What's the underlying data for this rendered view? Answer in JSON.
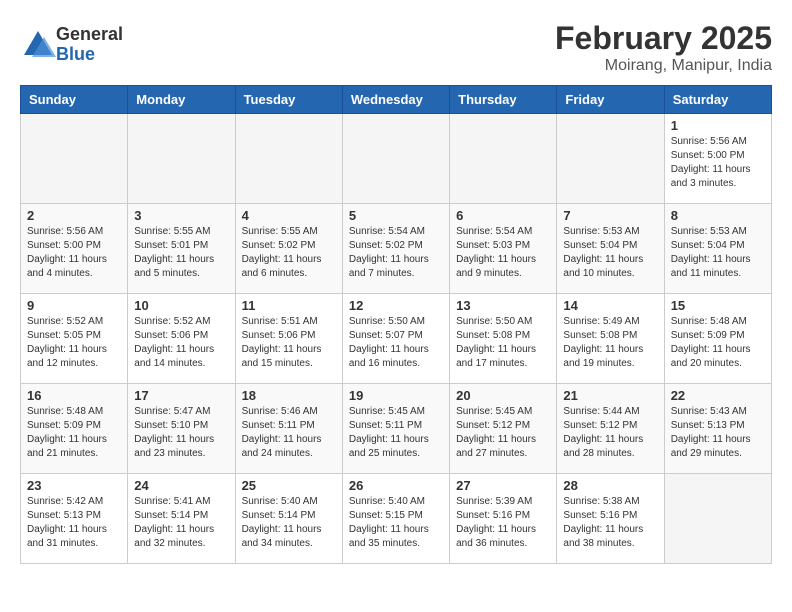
{
  "header": {
    "logo_general": "General",
    "logo_blue": "Blue",
    "title": "February 2025",
    "subtitle": "Moirang, Manipur, India"
  },
  "weekdays": [
    "Sunday",
    "Monday",
    "Tuesday",
    "Wednesday",
    "Thursday",
    "Friday",
    "Saturday"
  ],
  "weeks": [
    [
      {
        "day": "",
        "info": ""
      },
      {
        "day": "",
        "info": ""
      },
      {
        "day": "",
        "info": ""
      },
      {
        "day": "",
        "info": ""
      },
      {
        "day": "",
        "info": ""
      },
      {
        "day": "",
        "info": ""
      },
      {
        "day": "1",
        "info": "Sunrise: 5:56 AM\nSunset: 5:00 PM\nDaylight: 11 hours\nand 3 minutes."
      }
    ],
    [
      {
        "day": "2",
        "info": "Sunrise: 5:56 AM\nSunset: 5:00 PM\nDaylight: 11 hours\nand 4 minutes."
      },
      {
        "day": "3",
        "info": "Sunrise: 5:55 AM\nSunset: 5:01 PM\nDaylight: 11 hours\nand 5 minutes."
      },
      {
        "day": "4",
        "info": "Sunrise: 5:55 AM\nSunset: 5:02 PM\nDaylight: 11 hours\nand 6 minutes."
      },
      {
        "day": "5",
        "info": "Sunrise: 5:54 AM\nSunset: 5:02 PM\nDaylight: 11 hours\nand 7 minutes."
      },
      {
        "day": "6",
        "info": "Sunrise: 5:54 AM\nSunset: 5:03 PM\nDaylight: 11 hours\nand 9 minutes."
      },
      {
        "day": "7",
        "info": "Sunrise: 5:53 AM\nSunset: 5:04 PM\nDaylight: 11 hours\nand 10 minutes."
      },
      {
        "day": "8",
        "info": "Sunrise: 5:53 AM\nSunset: 5:04 PM\nDaylight: 11 hours\nand 11 minutes."
      }
    ],
    [
      {
        "day": "9",
        "info": "Sunrise: 5:52 AM\nSunset: 5:05 PM\nDaylight: 11 hours\nand 12 minutes."
      },
      {
        "day": "10",
        "info": "Sunrise: 5:52 AM\nSunset: 5:06 PM\nDaylight: 11 hours\nand 14 minutes."
      },
      {
        "day": "11",
        "info": "Sunrise: 5:51 AM\nSunset: 5:06 PM\nDaylight: 11 hours\nand 15 minutes."
      },
      {
        "day": "12",
        "info": "Sunrise: 5:50 AM\nSunset: 5:07 PM\nDaylight: 11 hours\nand 16 minutes."
      },
      {
        "day": "13",
        "info": "Sunrise: 5:50 AM\nSunset: 5:08 PM\nDaylight: 11 hours\nand 17 minutes."
      },
      {
        "day": "14",
        "info": "Sunrise: 5:49 AM\nSunset: 5:08 PM\nDaylight: 11 hours\nand 19 minutes."
      },
      {
        "day": "15",
        "info": "Sunrise: 5:48 AM\nSunset: 5:09 PM\nDaylight: 11 hours\nand 20 minutes."
      }
    ],
    [
      {
        "day": "16",
        "info": "Sunrise: 5:48 AM\nSunset: 5:09 PM\nDaylight: 11 hours\nand 21 minutes."
      },
      {
        "day": "17",
        "info": "Sunrise: 5:47 AM\nSunset: 5:10 PM\nDaylight: 11 hours\nand 23 minutes."
      },
      {
        "day": "18",
        "info": "Sunrise: 5:46 AM\nSunset: 5:11 PM\nDaylight: 11 hours\nand 24 minutes."
      },
      {
        "day": "19",
        "info": "Sunrise: 5:45 AM\nSunset: 5:11 PM\nDaylight: 11 hours\nand 25 minutes."
      },
      {
        "day": "20",
        "info": "Sunrise: 5:45 AM\nSunset: 5:12 PM\nDaylight: 11 hours\nand 27 minutes."
      },
      {
        "day": "21",
        "info": "Sunrise: 5:44 AM\nSunset: 5:12 PM\nDaylight: 11 hours\nand 28 minutes."
      },
      {
        "day": "22",
        "info": "Sunrise: 5:43 AM\nSunset: 5:13 PM\nDaylight: 11 hours\nand 29 minutes."
      }
    ],
    [
      {
        "day": "23",
        "info": "Sunrise: 5:42 AM\nSunset: 5:13 PM\nDaylight: 11 hours\nand 31 minutes."
      },
      {
        "day": "24",
        "info": "Sunrise: 5:41 AM\nSunset: 5:14 PM\nDaylight: 11 hours\nand 32 minutes."
      },
      {
        "day": "25",
        "info": "Sunrise: 5:40 AM\nSunset: 5:14 PM\nDaylight: 11 hours\nand 34 minutes."
      },
      {
        "day": "26",
        "info": "Sunrise: 5:40 AM\nSunset: 5:15 PM\nDaylight: 11 hours\nand 35 minutes."
      },
      {
        "day": "27",
        "info": "Sunrise: 5:39 AM\nSunset: 5:16 PM\nDaylight: 11 hours\nand 36 minutes."
      },
      {
        "day": "28",
        "info": "Sunrise: 5:38 AM\nSunset: 5:16 PM\nDaylight: 11 hours\nand 38 minutes."
      },
      {
        "day": "",
        "info": ""
      }
    ]
  ]
}
